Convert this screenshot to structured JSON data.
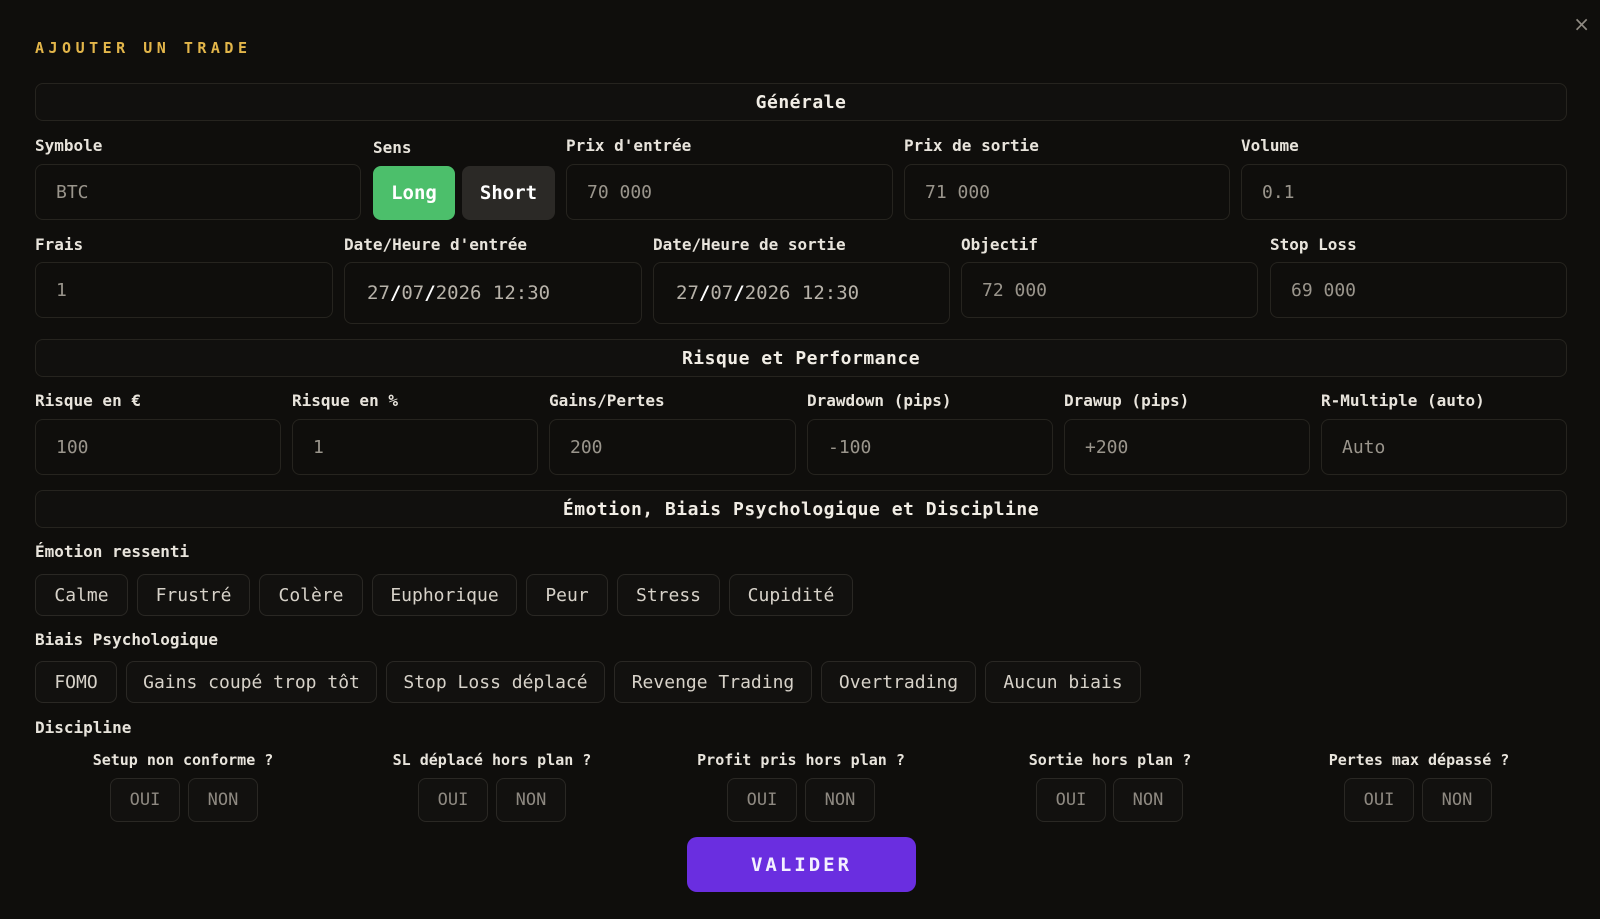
{
  "modal": {
    "title": "AJOUTER UN TRADE",
    "close_label": "×",
    "submit_label": "VALIDER"
  },
  "general": {
    "header": "Générale",
    "symbol": {
      "label": "Symbole",
      "placeholder": "BTC"
    },
    "sens": {
      "label": "Sens",
      "long_label": "Long",
      "short_label": "Short",
      "selected": "Long"
    },
    "entry_price": {
      "label": "Prix d'entrée",
      "placeholder": "70 000"
    },
    "exit_price": {
      "label": "Prix de sortie",
      "placeholder": "71 000"
    },
    "volume": {
      "label": "Volume",
      "placeholder": "0.1"
    },
    "fees": {
      "label": "Frais",
      "placeholder": "1"
    },
    "entry_datetime": {
      "label": "Date/Heure d'entrée",
      "day": "27",
      "month": "07",
      "year": "2026",
      "time": "12:30",
      "sep": "/"
    },
    "exit_datetime": {
      "label": "Date/Heure de sortie",
      "day": "27",
      "month": "07",
      "year": "2026",
      "time": "12:30",
      "sep": "/"
    },
    "target": {
      "label": "Objectif",
      "placeholder": "72 000"
    },
    "stop_loss": {
      "label": "Stop Loss",
      "placeholder": "69 000"
    }
  },
  "risk": {
    "header": "Risque et Performance",
    "risk_eur": {
      "label": "Risque en €",
      "placeholder": "100"
    },
    "risk_pct": {
      "label": "Risque en %",
      "placeholder": "1"
    },
    "pnl": {
      "label": "Gains/Pertes",
      "placeholder": "200"
    },
    "drawdown": {
      "label": "Drawdown (pips)",
      "placeholder": "-100"
    },
    "drawup": {
      "label": "Drawup (pips)",
      "placeholder": "+200"
    },
    "r_multiple": {
      "label": "R-Multiple (auto)",
      "placeholder": "Auto"
    }
  },
  "psych": {
    "header": "Émotion, Biais Psychologique et Discipline",
    "emotion_label": "Émotion ressenti",
    "emotions": [
      "Calme",
      "Frustré",
      "Colère",
      "Euphorique",
      "Peur",
      "Stress",
      "Cupidité"
    ],
    "bias_label": "Biais Psychologique",
    "biases": [
      "FOMO",
      "Gains coupé trop tôt",
      "Stop Loss déplacé",
      "Revenge Trading",
      "Overtrading",
      "Aucun biais"
    ],
    "discipline_label": "Discipline",
    "discipline": [
      {
        "question": "Setup non conforme ?",
        "yes": "OUI",
        "no": "NON"
      },
      {
        "question": "SL déplacé hors plan ?",
        "yes": "OUI",
        "no": "NON"
      },
      {
        "question": "Profit pris hors plan ?",
        "yes": "OUI",
        "no": "NON"
      },
      {
        "question": "Sortie hors plan ?",
        "yes": "OUI",
        "no": "NON"
      },
      {
        "question": "Pertes max dépassé ?",
        "yes": "OUI",
        "no": "NON"
      }
    ]
  }
}
